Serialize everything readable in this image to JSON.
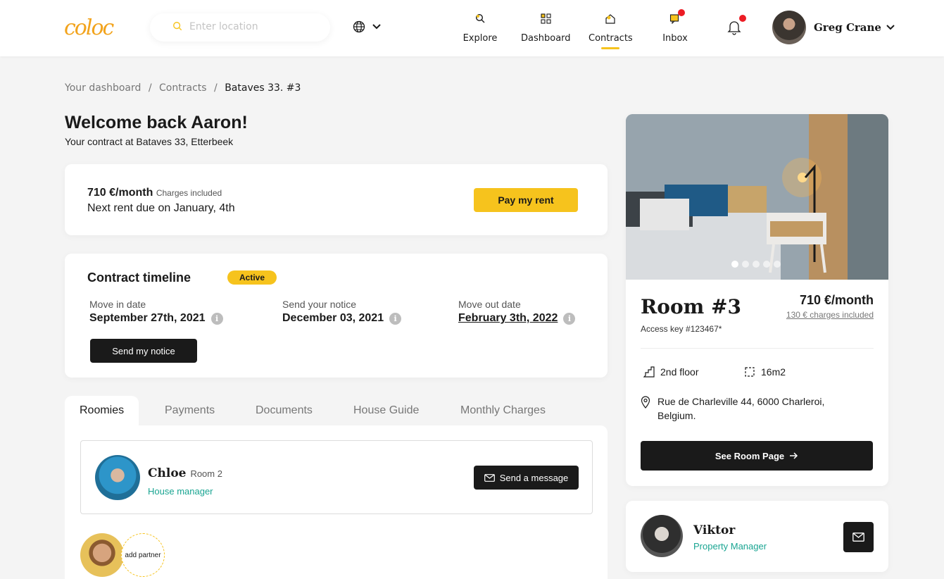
{
  "header": {
    "logo": "coloc",
    "search_placeholder": "Enter location",
    "nav": [
      {
        "label": "Explore"
      },
      {
        "label": "Dashboard"
      },
      {
        "label": "Contracts"
      },
      {
        "label": "Inbox"
      }
    ],
    "active_nav": "Contracts",
    "user_name": "Greg Crane"
  },
  "breadcrumb": {
    "items": [
      "Your dashboard",
      "Contracts",
      "Bataves 33. #3"
    ],
    "separator": "/"
  },
  "welcome": {
    "title": "Welcome back Aaron!",
    "subtitle": "Your contract at Bataves 33, Etterbeek"
  },
  "rent": {
    "amount": "710 €/month",
    "charges_note": "Charges included",
    "due": "Next rent due on January, 4th",
    "pay_button": "Pay my rent"
  },
  "timeline": {
    "title": "Contract timeline",
    "status": "Active",
    "columns": [
      {
        "label": "Move in date",
        "value": "September 27th, 2021"
      },
      {
        "label": "Send your notice",
        "value": "December 03, 2021"
      },
      {
        "label": "Move out date",
        "value": "February 3th, 2022"
      }
    ],
    "notice_button": "Send my notice"
  },
  "tabs": [
    "Roomies",
    "Payments",
    "Documents",
    "House Guide",
    "Monthly Charges"
  ],
  "roomie": {
    "name": "Chloe",
    "room": "Room 2",
    "role": "House manager",
    "message_button": "Send a message"
  },
  "partner": {
    "add_label": "add partner"
  },
  "room": {
    "title": "Room #3",
    "access_key": "Access key #123467*",
    "price": "710 €/month",
    "charges": "130 € charges included",
    "floor": "2nd floor",
    "area": "16m2",
    "address_line1": "Rue de Charleville 44, 6000 Charleroi,",
    "address_line2": "Belgium.",
    "button": "See Room Page",
    "photo_count": 5,
    "photo_active": 1
  },
  "manager": {
    "name": "Viktor",
    "role": "Property Manager"
  },
  "colors": {
    "accent_yellow": "#f6c31d",
    "logo_orange": "#f2a31c",
    "teal": "#1aa592",
    "dark": "#1a1a1a",
    "notification_red": "#ec1c24"
  }
}
